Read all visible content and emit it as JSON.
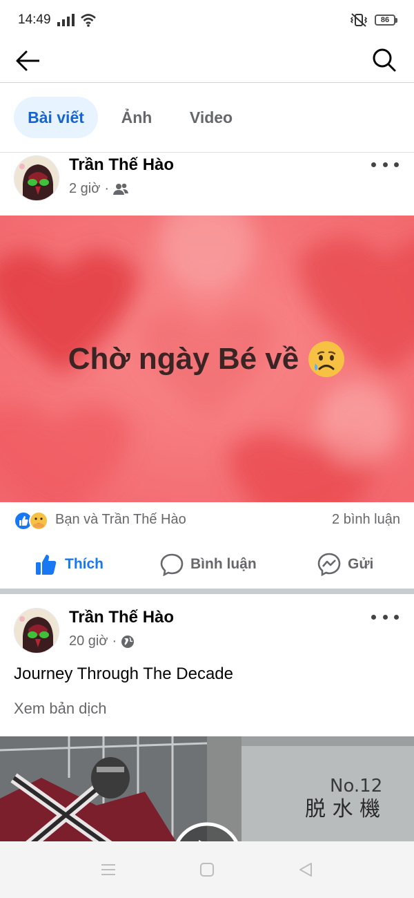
{
  "status": {
    "time": "14:49",
    "battery": "86"
  },
  "nav": {
    "back_icon": "arrow-left-icon",
    "search_icon": "search-icon"
  },
  "tabs": [
    {
      "label": "Bài viết",
      "active": true
    },
    {
      "label": "Ảnh",
      "active": false
    },
    {
      "label": "Video",
      "active": false
    }
  ],
  "posts": [
    {
      "author": "Trần Thế Hào",
      "time": "2 giờ",
      "audience_icon": "friends-icon",
      "background_text": "Chờ ngày Bé về",
      "background_emoji": "😥",
      "reactions_text": "Bạn và Trần Thế Hào",
      "comments": "2 bình luận",
      "actions": {
        "like": "Thích",
        "comment": "Bình luận",
        "send": "Gửi"
      }
    },
    {
      "author": "Trần Thế Hào",
      "time": "20 giờ",
      "audience_icon": "globe-icon",
      "text": "Journey Through The Decade",
      "translate": "Xem bản dịch"
    }
  ],
  "colors": {
    "accent": "#1877f2",
    "tab_active_bg": "#e7f3ff",
    "banner": "#f26a6f"
  }
}
